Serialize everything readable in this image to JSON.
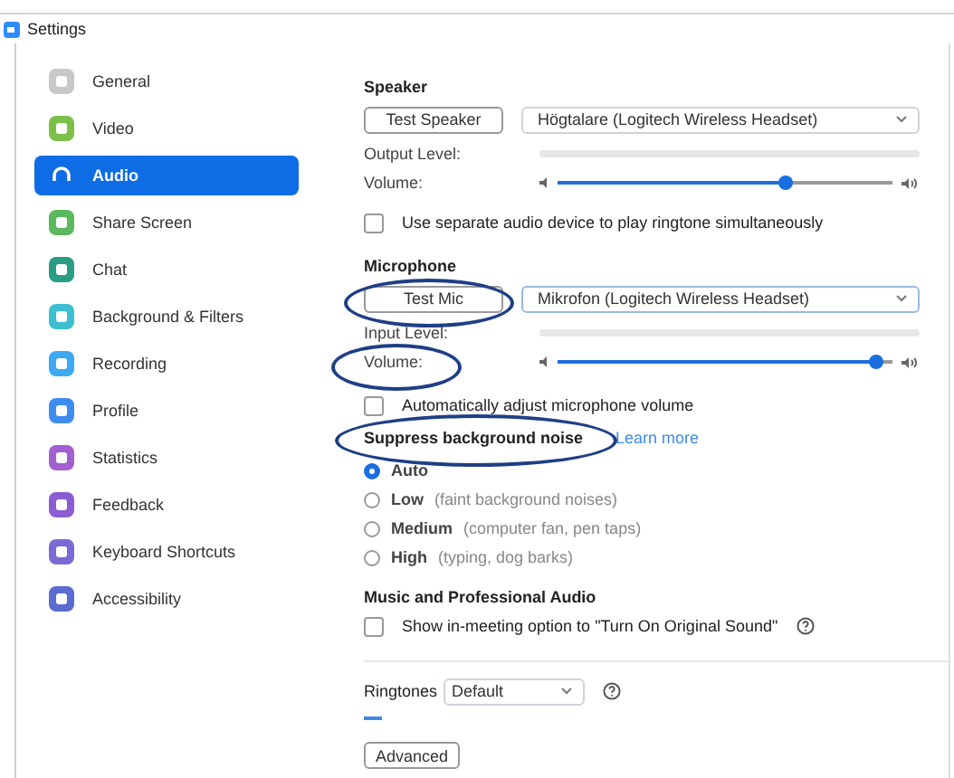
{
  "window": {
    "title": "Settings"
  },
  "sidebar": {
    "items": [
      {
        "label": "General",
        "selected": false,
        "color": "#c8c8c8"
      },
      {
        "label": "Video",
        "selected": false,
        "color": "#7cc04a"
      },
      {
        "label": "Audio",
        "selected": true,
        "color": "#ffffff"
      },
      {
        "label": "Share Screen",
        "selected": false,
        "color": "#5cb85c"
      },
      {
        "label": "Chat",
        "selected": false,
        "color": "#2a9d84"
      },
      {
        "label": "Background & Filters",
        "selected": false,
        "color": "#3cbfd0"
      },
      {
        "label": "Recording",
        "selected": false,
        "color": "#3ea8f2"
      },
      {
        "label": "Profile",
        "selected": false,
        "color": "#3f8cef"
      },
      {
        "label": "Statistics",
        "selected": false,
        "color": "#a25fd0"
      },
      {
        "label": "Feedback",
        "selected": false,
        "color": "#8c5cd2"
      },
      {
        "label": "Keyboard Shortcuts",
        "selected": false,
        "color": "#7a6bd4"
      },
      {
        "label": "Accessibility",
        "selected": false,
        "color": "#5a6cd0"
      }
    ]
  },
  "speaker": {
    "heading": "Speaker",
    "test_button": "Test Speaker",
    "device": "Högtalare (Logitech Wireless Headset)",
    "meter_label": "Output Level:",
    "volume_label": "Volume:",
    "level": 0.68,
    "separate_device": {
      "label": "Use separate audio device to play ringtone simultaneously",
      "checked": false
    }
  },
  "microphone": {
    "heading": "Microphone",
    "test_button": "Test Mic",
    "device": "Mikrofon (Logitech Wireless Headset)",
    "meter_label": "Input Level:",
    "volume_label": "Volume:",
    "level": 0.95,
    "auto_adjust": {
      "label": "Automatically adjust microphone volume",
      "checked": false
    }
  },
  "noise": {
    "heading": "Suppress background noise",
    "link": "Learn more",
    "options": [
      {
        "label": "Auto",
        "selected": true
      },
      {
        "label": "Low",
        "note": "(faint background noises)",
        "selected": false
      },
      {
        "label": "Medium",
        "note": "(computer fan, pen taps)",
        "selected": false
      },
      {
        "label": "High",
        "note": "(typing, dog barks)",
        "selected": false
      }
    ]
  },
  "music": {
    "heading": "Music and Professional Audio",
    "original_sound": {
      "label": "Show in-meeting option to \"Turn On Original Sound\"",
      "checked": false
    }
  },
  "ringtones": {
    "label": "Ringtones",
    "value": "Default"
  },
  "advanced_button": "Advanced"
}
